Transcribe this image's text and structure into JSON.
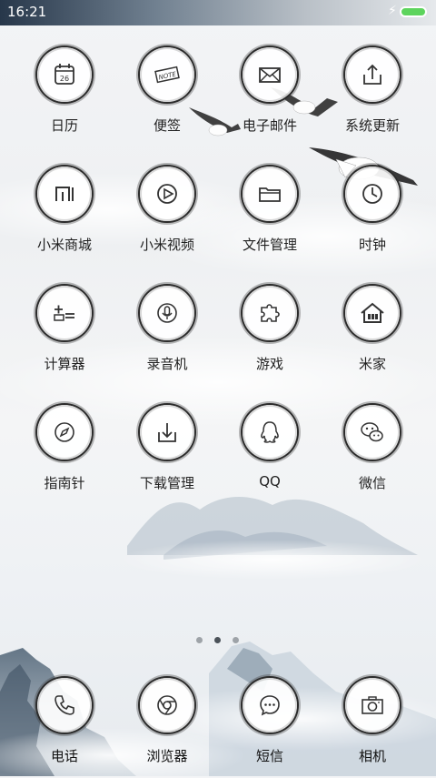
{
  "status_bar": {
    "time": "16:21",
    "battery_color": "#5dd45d"
  },
  "apps": [
    {
      "label": "日历",
      "icon": "calendar-icon",
      "date": "26"
    },
    {
      "label": "便签",
      "icon": "note-icon",
      "text": "NOTE"
    },
    {
      "label": "电子邮件",
      "icon": "email-icon"
    },
    {
      "label": "系统更新",
      "icon": "upload-icon"
    },
    {
      "label": "小米商城",
      "icon": "mi-store-icon"
    },
    {
      "label": "小米视频",
      "icon": "video-play-icon"
    },
    {
      "label": "文件管理",
      "icon": "folder-icon"
    },
    {
      "label": "时钟",
      "icon": "clock-icon"
    },
    {
      "label": "计算器",
      "icon": "calculator-icon"
    },
    {
      "label": "录音机",
      "icon": "microphone-icon"
    },
    {
      "label": "游戏",
      "icon": "puzzle-icon"
    },
    {
      "label": "米家",
      "icon": "home-icon"
    },
    {
      "label": "指南针",
      "icon": "compass-icon"
    },
    {
      "label": "下载管理",
      "icon": "download-icon"
    },
    {
      "label": "QQ",
      "icon": "qq-penguin-icon"
    },
    {
      "label": "微信",
      "icon": "wechat-icon"
    }
  ],
  "page_indicator": {
    "count": 3,
    "active": 1
  },
  "dock": [
    {
      "label": "电话",
      "icon": "phone-icon"
    },
    {
      "label": "浏览器",
      "icon": "browser-icon"
    },
    {
      "label": "短信",
      "icon": "message-icon"
    },
    {
      "label": "相机",
      "icon": "camera-icon"
    }
  ]
}
